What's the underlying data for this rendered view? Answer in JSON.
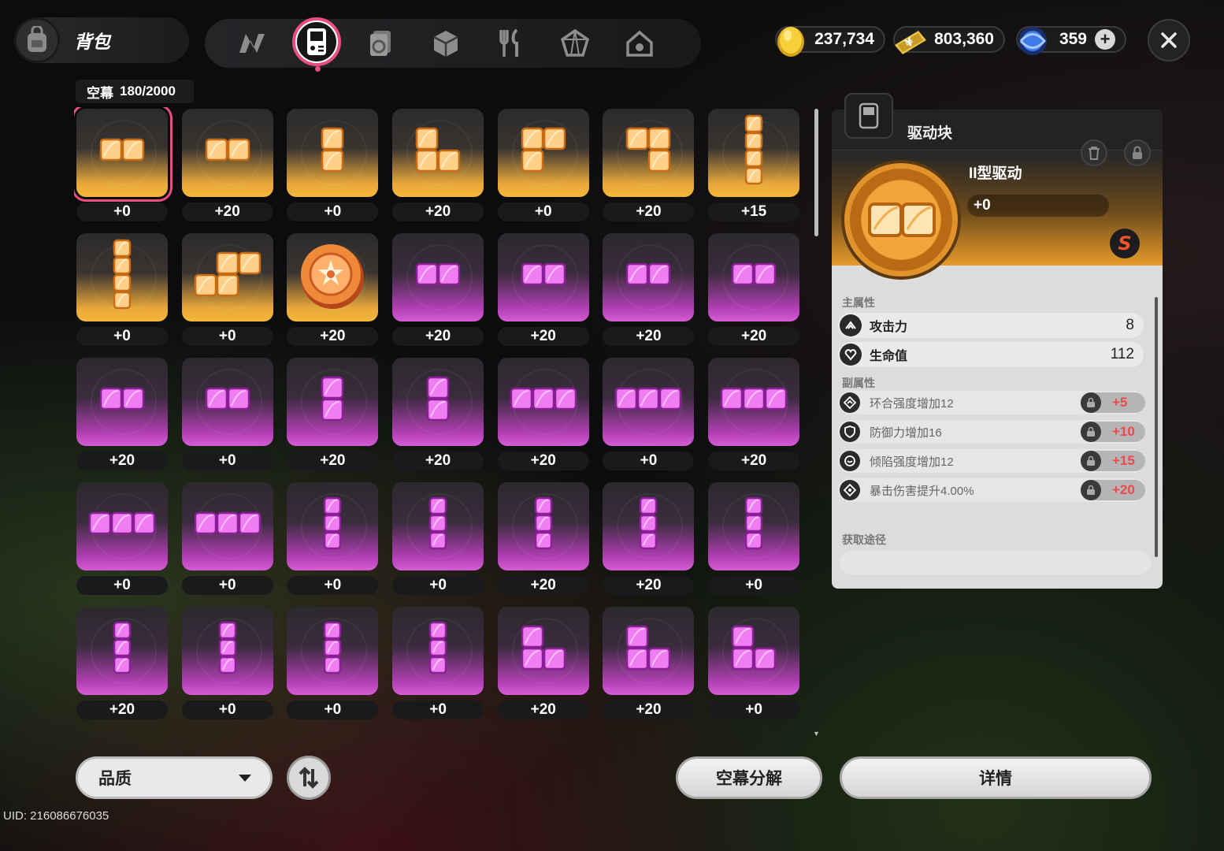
{
  "header": {
    "bag_title": "背包",
    "nav_tabs": [
      {
        "icon": "n-logo-icon",
        "active": false
      },
      {
        "icon": "handheld-device-icon",
        "active": true
      },
      {
        "icon": "card-stack-icon",
        "active": false
      },
      {
        "icon": "cube-icon",
        "active": false
      },
      {
        "icon": "utensils-icon",
        "active": false
      },
      {
        "icon": "crystal-box-icon",
        "active": false
      },
      {
        "icon": "home-icon",
        "active": false
      }
    ],
    "currencies": [
      {
        "icon": "gold-coin-icon",
        "value": "237,734"
      },
      {
        "icon": "ticket-icon",
        "value": "803,360"
      },
      {
        "icon": "blue-crystal-icon",
        "value": "359"
      }
    ],
    "plus_label": "+",
    "close_label": "✕"
  },
  "inventory": {
    "capacity_label": "空幕",
    "capacity_value": "180/2000",
    "items": [
      {
        "color": "gold",
        "shape": "h2",
        "level": "+0",
        "selected": true
      },
      {
        "color": "gold",
        "shape": "h2",
        "level": "+20"
      },
      {
        "color": "gold",
        "shape": "v2",
        "level": "+0"
      },
      {
        "color": "gold",
        "shape": "L",
        "level": "+20"
      },
      {
        "color": "gold",
        "shape": "P",
        "level": "+0"
      },
      {
        "color": "gold",
        "shape": "J",
        "level": "+20"
      },
      {
        "color": "gold",
        "shape": "v4",
        "level": "+15"
      },
      {
        "color": "gold",
        "shape": "v4",
        "level": "+0"
      },
      {
        "color": "gold",
        "shape": "S",
        "level": "+0"
      },
      {
        "color": "gold",
        "shape": "coin",
        "level": "+20"
      },
      {
        "color": "purple",
        "shape": "h2",
        "level": "+20"
      },
      {
        "color": "purple",
        "shape": "h2",
        "level": "+20"
      },
      {
        "color": "purple",
        "shape": "h2",
        "level": "+20"
      },
      {
        "color": "purple",
        "shape": "h2",
        "level": "+20"
      },
      {
        "color": "purple",
        "shape": "h2",
        "level": "+20"
      },
      {
        "color": "purple",
        "shape": "h2",
        "level": "+0"
      },
      {
        "color": "purple",
        "shape": "v2",
        "level": "+20"
      },
      {
        "color": "purple",
        "shape": "v2",
        "level": "+20"
      },
      {
        "color": "purple",
        "shape": "h3",
        "level": "+20"
      },
      {
        "color": "purple",
        "shape": "h3",
        "level": "+0"
      },
      {
        "color": "purple",
        "shape": "h3",
        "level": "+20"
      },
      {
        "color": "purple",
        "shape": "h3",
        "level": "+0"
      },
      {
        "color": "purple",
        "shape": "h3",
        "level": "+0"
      },
      {
        "color": "purple",
        "shape": "v3",
        "level": "+0"
      },
      {
        "color": "purple",
        "shape": "v3",
        "level": "+0"
      },
      {
        "color": "purple",
        "shape": "v3",
        "level": "+20"
      },
      {
        "color": "purple",
        "shape": "v3",
        "level": "+20"
      },
      {
        "color": "purple",
        "shape": "v3",
        "level": "+0"
      },
      {
        "color": "purple",
        "shape": "v3",
        "level": "+20"
      },
      {
        "color": "purple",
        "shape": "v3",
        "level": "+0"
      },
      {
        "color": "purple",
        "shape": "v3",
        "level": "+0"
      },
      {
        "color": "purple",
        "shape": "v3",
        "level": "+0"
      },
      {
        "color": "purple",
        "shape": "L",
        "level": "+20"
      },
      {
        "color": "purple",
        "shape": "L",
        "level": "+20"
      },
      {
        "color": "purple",
        "shape": "L",
        "level": "+0"
      }
    ]
  },
  "detail": {
    "panel_title": "驱动块",
    "item_name": "II型驱动",
    "item_level": "+0",
    "main_attr_label": "主属性",
    "main_attrs": [
      {
        "icon": "attack-icon",
        "name": "攻击力",
        "value": "8"
      },
      {
        "icon": "heart-icon",
        "name": "生命值",
        "value": "112"
      }
    ],
    "sub_attr_label": "副属性",
    "sub_attrs": [
      {
        "icon": "hex-arrow-icon",
        "name": "环合强度增加12",
        "bonus": "+5"
      },
      {
        "icon": "shield-icon",
        "name": "防御力增加16",
        "bonus": "+10"
      },
      {
        "icon": "smile-icon",
        "name": "倾陷强度增加12",
        "bonus": "+15"
      },
      {
        "icon": "crit-icon",
        "name": "暴击伤害提升4.00%",
        "bonus": "+20"
      }
    ],
    "acquire_label": "获取途径"
  },
  "footer": {
    "quality_label": "品质",
    "decompose_label": "空幕分解",
    "details_label": "详情",
    "uid_text": "UID: 216086676035"
  },
  "colors": {
    "accent_pink": "#ea4d7f",
    "gold": "#f4b73b",
    "purple": "#d65cd6",
    "bonus_red": "#ea4b4b"
  }
}
